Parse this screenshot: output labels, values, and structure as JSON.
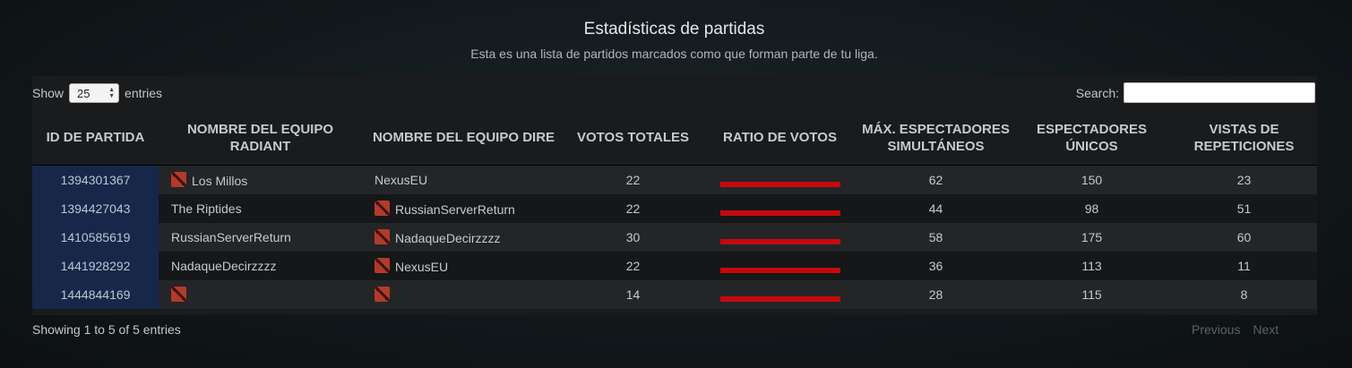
{
  "header": {
    "title": "Estadísticas de partidas",
    "subtitle": "Esta es una lista de partidos marcados como que forman parte de tu liga."
  },
  "controls": {
    "show_label": "Show",
    "page_size": "25",
    "entries_label": "entries",
    "search_label": "Search:",
    "search_value": ""
  },
  "columns": [
    "ID DE PARTIDA",
    "NOMBRE DEL EQUIPO RADIANT",
    "NOMBRE DEL EQUIPO DIRE",
    "VOTOS TOTALES",
    "RATIO DE VOTOS",
    "MÁX. ESPECTADORES SIMULTÁNEOS",
    "ESPECTADORES ÚNICOS",
    "VISTAS DE REPETICIONES"
  ],
  "rows": [
    {
      "id": "1394301367",
      "radiant": "Los Millos",
      "radiant_icon": "dota-icon",
      "dire": "NexusEU",
      "dire_icon": "",
      "votes": "22",
      "vote_ratio": 1.0,
      "max_spectators": "62",
      "unique_spectators": "150",
      "replay_views": "23"
    },
    {
      "id": "1394427043",
      "radiant": "The Riptides",
      "radiant_icon": "",
      "dire": "RussianServerReturn",
      "dire_icon": "dota-icon",
      "votes": "22",
      "vote_ratio": 1.0,
      "max_spectators": "44",
      "unique_spectators": "98",
      "replay_views": "51"
    },
    {
      "id": "1410585619",
      "radiant": "RussianServerReturn",
      "radiant_icon": "",
      "dire": "NadaqueDecirzzzz",
      "dire_icon": "dota-icon",
      "votes": "30",
      "vote_ratio": 1.0,
      "max_spectators": "58",
      "unique_spectators": "175",
      "replay_views": "60"
    },
    {
      "id": "1441928292",
      "radiant": "NadaqueDecirzzzz",
      "radiant_icon": "",
      "dire": "NexusEU",
      "dire_icon": "dota-icon",
      "votes": "22",
      "vote_ratio": 1.0,
      "max_spectators": "36",
      "unique_spectators": "113",
      "replay_views": "11"
    },
    {
      "id": "1444844169",
      "radiant": "",
      "radiant_icon": "dota-icon",
      "dire": "",
      "dire_icon": "dota-icon",
      "votes": "14",
      "vote_ratio": 1.0,
      "max_spectators": "28",
      "unique_spectators": "115",
      "replay_views": "8"
    }
  ],
  "footer": {
    "info": "Showing 1 to 5 of 5 entries",
    "previous": "Previous",
    "next": "Next"
  },
  "colors": {
    "ratio_bar": "#c5090d",
    "id_cell_bg": "#16274a"
  }
}
